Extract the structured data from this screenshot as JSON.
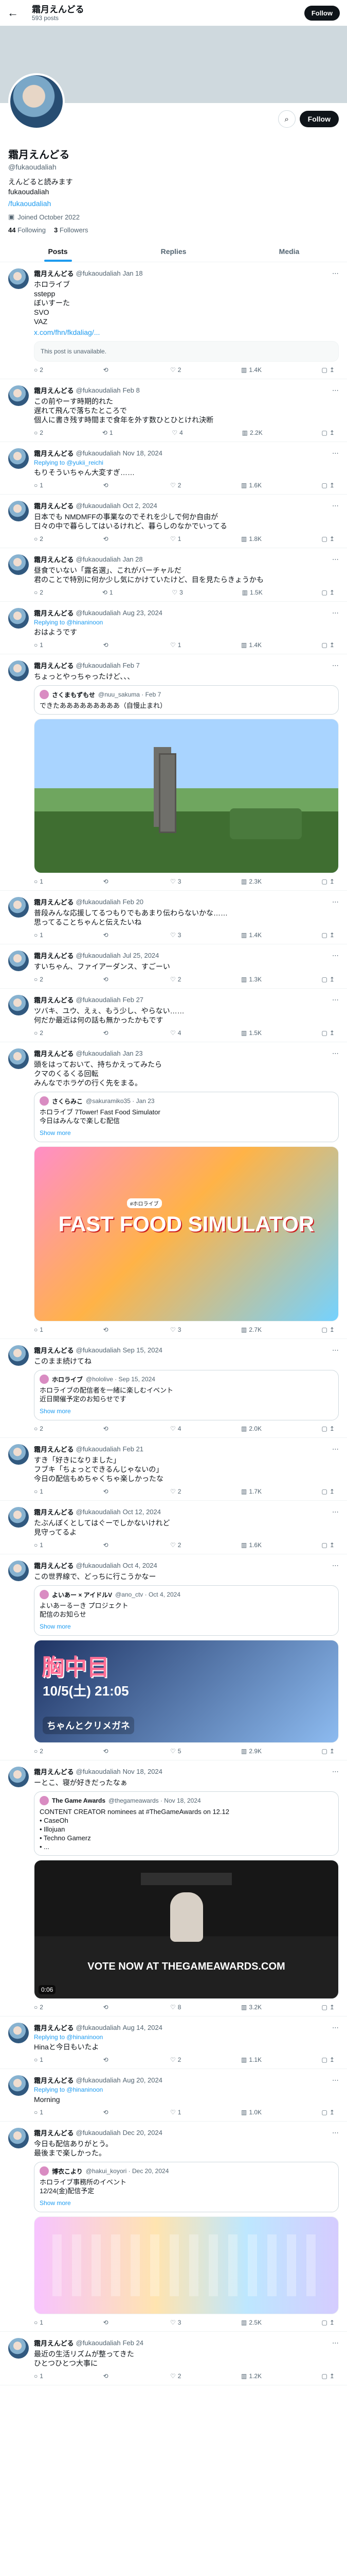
{
  "header": {
    "back_icon": "←",
    "name": "霜月えんどる",
    "subtitle": "593 posts",
    "follow_label": "Follow"
  },
  "profile": {
    "name": "霜月えんどる",
    "handle": "@fukaoudaliah",
    "bio": "えんどると読みます\nfukaoudaliah",
    "link": "/fukaoudaliah",
    "joined": "Joined October 2022",
    "following_label": "Following",
    "followers_label": "Followers",
    "following": "44",
    "followers": "3",
    "follow_label": "Follow",
    "search_icon": "⌕",
    "menu_icon": "⋯"
  },
  "tabs": [
    {
      "label": "Posts"
    },
    {
      "label": "Replies"
    },
    {
      "label": "Media"
    }
  ],
  "posts": [
    {
      "name": "霜月えんどる",
      "handle": "@fukaoudaliah",
      "date": "Jan 18",
      "text": "ホロライブ\nsstepp\nぼいすーた\nSVO\nVAZ",
      "link": "x.com/fhn/fkdaliag/...",
      "unavailable": "This post is unavailable.",
      "stats": {
        "reply": "2",
        "repost": "",
        "like": "2",
        "views": "1.4K"
      }
    },
    {
      "name": "霜月えんどる",
      "handle": "@fukaoudaliah",
      "date": "Feb 8",
      "text": "この前やーす時期的れた\n遅れて飛んで落ちたところで\n個人に書き残す時間まで食年を外す数ひとひとけれ決断",
      "stats": {
        "reply": "2",
        "repost": "1",
        "like": "4",
        "views": "2.2K"
      }
    },
    {
      "name": "霜月えんどる",
      "handle": "@fukaoudaliah",
      "date": "Nov 18, 2024",
      "reply_prefix": "Replying to",
      "reply_to": "@yukii_reichi",
      "text": "もりそういちゃん大変すぎ……",
      "stats": {
        "reply": "1",
        "repost": "",
        "like": "2",
        "views": "1.6K"
      }
    },
    {
      "name": "霜月えんどる",
      "handle": "@fukaoudaliah",
      "date": "Oct 2, 2024",
      "text": "日本でも NMDMFFの事業なのでそれを少しで何か自由が\n日々の中で暮らしてはいるけれど、暮らしのなかでいってる",
      "stats": {
        "reply": "2",
        "repost": "",
        "like": "1",
        "views": "1.8K"
      }
    },
    {
      "name": "霜月えんどる",
      "handle": "@fukaoudaliah",
      "date": "Jan 28",
      "text": "昼食でいない「露名選」、これがバーチャルだ\n君のことで特別に何か少し気にかけていたけど、目を見たらきょうかも",
      "stats": {
        "reply": "2",
        "repost": "1",
        "like": "3",
        "views": "1.5K"
      }
    },
    {
      "name": "霜月えんどる",
      "handle": "@fukaoudaliah",
      "date": "Aug 23, 2024",
      "reply_prefix": "Replying to",
      "reply_to": "@hinaninoon",
      "text": "おはようです",
      "stats": {
        "reply": "1",
        "repost": "",
        "like": "1",
        "views": "1.4K"
      }
    },
    {
      "name": "霜月えんどる",
      "handle": "@fukaoudaliah",
      "date": "Feb 7",
      "text": "ちょっとやっちゃったけど、、、",
      "quote_name": "さくまもずもせ",
      "quote_meta": "@nuu_sakuma · Feb 7",
      "quote_text": "できたあああああああああ（自慢止まれ）",
      "stats": {
        "reply": "1",
        "repost": "",
        "like": "3",
        "views": "2.3K"
      }
    },
    {
      "name": "霜月えんどる",
      "handle": "@fukaoudaliah",
      "date": "Feb 20",
      "text": "普段みんな応援してるつもりでもあまり伝わらないかな……\n思ってることちゃんと伝えたいね",
      "stats": {
        "reply": "1",
        "repost": "",
        "like": "3",
        "views": "1.4K"
      }
    },
    {
      "name": "霜月えんどる",
      "handle": "@fukaoudaliah",
      "date": "Jul 25, 2024",
      "text": "すいちゃん、ファイアーダンス、すごーい",
      "stats": {
        "reply": "2",
        "repost": "",
        "like": "2",
        "views": "1.3K"
      }
    },
    {
      "name": "霜月えんどる",
      "handle": "@fukaoudaliah",
      "date": "Feb 27",
      "text": "ツバキ、ユウ、えぇ、もう少し、やらない……\n何だか最近は何の話も無かったかもです",
      "stats": {
        "reply": "2",
        "repost": "",
        "like": "4",
        "views": "1.5K"
      }
    },
    {
      "name": "霜月えんどる",
      "handle": "@fukaoudaliah",
      "date": "Jan 23",
      "text": "頭をはっておいて、持ちかえってみたら\nクマのくるくる回転\nみんなでホラゲの行く先をまる。",
      "quote_name": "さくらみこ",
      "quote_meta": "@sakuramiko35 · Jan 23",
      "quote_text": "ホロライブ 7Tower! Fast Food Simulator\n今日はみんなで楽しむ配信",
      "banner": "FAST FOOD SIMULATOR",
      "banner_small": "#ホロライブ",
      "show_more": "Show more",
      "stats": {
        "reply": "1",
        "repost": "",
        "like": "3",
        "views": "2.7K"
      }
    },
    {
      "name": "霜月えんどる",
      "handle": "@fukaoudaliah",
      "date": "Sep 15, 2024",
      "text": "このまま続けてね",
      "quote_name": "ホロライブ",
      "quote_meta": "@hololive · Sep 15, 2024",
      "quote_text": "ホロライブの配信者を一緒に楽しむイベント\n近日開催予定のお知らせです",
      "show_more": "Show more",
      "stats": {
        "reply": "2",
        "repost": "",
        "like": "4",
        "views": "2.0K"
      }
    },
    {
      "name": "霜月えんどる",
      "handle": "@fukaoudaliah",
      "date": "Feb 21",
      "text": "すき「好きになりました」\nフブキ「ちょっとできるんじゃないの」\n今日の配信もめちゃくちゃ楽しかったな",
      "stats": {
        "reply": "1",
        "repost": "",
        "like": "2",
        "views": "1.7K"
      }
    },
    {
      "name": "霜月えんどる",
      "handle": "@fukaoudaliah",
      "date": "Oct 12, 2024",
      "text": "たぶんぼくとしてはぐーでしかないけれど\n見守ってるよ",
      "stats": {
        "reply": "1",
        "repost": "",
        "like": "2",
        "views": "1.6K"
      }
    },
    {
      "name": "霜月えんどる",
      "handle": "@fukaoudaliah",
      "date": "Oct 4, 2024",
      "text": "この世界線で、どっちに行こうかなー",
      "quote_name": "よいあー × アイドルV",
      "quote_meta": "@ano_ctv · Oct 4, 2024",
      "quote_text": "よいあーるーき プロジェクト\n配信のお知らせ",
      "show_more": "Show more",
      "poster_1": "胸中目",
      "poster_2": "10/5(土) 21:05",
      "poster_3": "ちゃんとクリメガネ",
      "stats": {
        "reply": "2",
        "repost": "",
        "like": "5",
        "views": "2.9K"
      }
    },
    {
      "name": "霜月えんどる",
      "handle": "@fukaoudaliah",
      "date": "Nov 18, 2024",
      "text": "ーとこ、寝が好きだったなぁ",
      "quote_name": "The Game Awards",
      "quote_meta": "@thegameawards · Nov 18, 2024",
      "quote_text": "CONTENT CREATOR nominees at #TheGameAwards on 12.12\n• CaseOh\n• Illojuan\n• Techno Gamerz\n• ...",
      "video_caption": "VOTE NOW AT THEGAMEAWARDS.COM",
      "video_time": "0:06",
      "stats": {
        "reply": "2",
        "repost": "",
        "like": "8",
        "views": "3.2K"
      }
    },
    {
      "name": "霜月えんどる",
      "handle": "@fukaoudaliah",
      "date": "Aug 14, 2024",
      "reply_prefix": "Replying to",
      "reply_to": "@hinaninoon",
      "text": "Hinaと今日もいたよ",
      "stats": {
        "reply": "1",
        "repost": "",
        "like": "2",
        "views": "1.1K"
      }
    },
    {
      "name": "霜月えんどる",
      "handle": "@fukaoudaliah",
      "date": "Aug 20, 2024",
      "reply_prefix": "Replying to",
      "reply_to": "@hinaninoon",
      "text": "Morning",
      "stats": {
        "reply": "1",
        "repost": "",
        "like": "1",
        "views": "1.0K"
      }
    },
    {
      "name": "霜月えんどる",
      "handle": "@fukaoudaliah",
      "date": "Dec 20, 2024",
      "text": "今日も配信ありがとう。\n最後まで楽しかった。",
      "quote_name": "博衣こより",
      "quote_meta": "@hakui_koyori · Dec 20, 2024",
      "quote_text": "ホロライブ事務所のイベント\n12/24(金)配信予定",
      "show_more": "Show more",
      "stats": {
        "reply": "1",
        "repost": "",
        "like": "3",
        "views": "2.5K"
      }
    },
    {
      "name": "霜月えんどる",
      "handle": "@fukaoudaliah",
      "date": "Feb 24",
      "text": "最近の生活リズムが整ってきた\nひとつひとつ大事に",
      "stats": {
        "reply": "1",
        "repost": "",
        "like": "2",
        "views": "1.2K"
      }
    }
  ],
  "icons": {
    "reply": "○",
    "repost": "⟲",
    "like": "♡",
    "views": "▥",
    "bookmark": "▢",
    "share": "↥",
    "more": "⋯",
    "calendar": "▣"
  }
}
